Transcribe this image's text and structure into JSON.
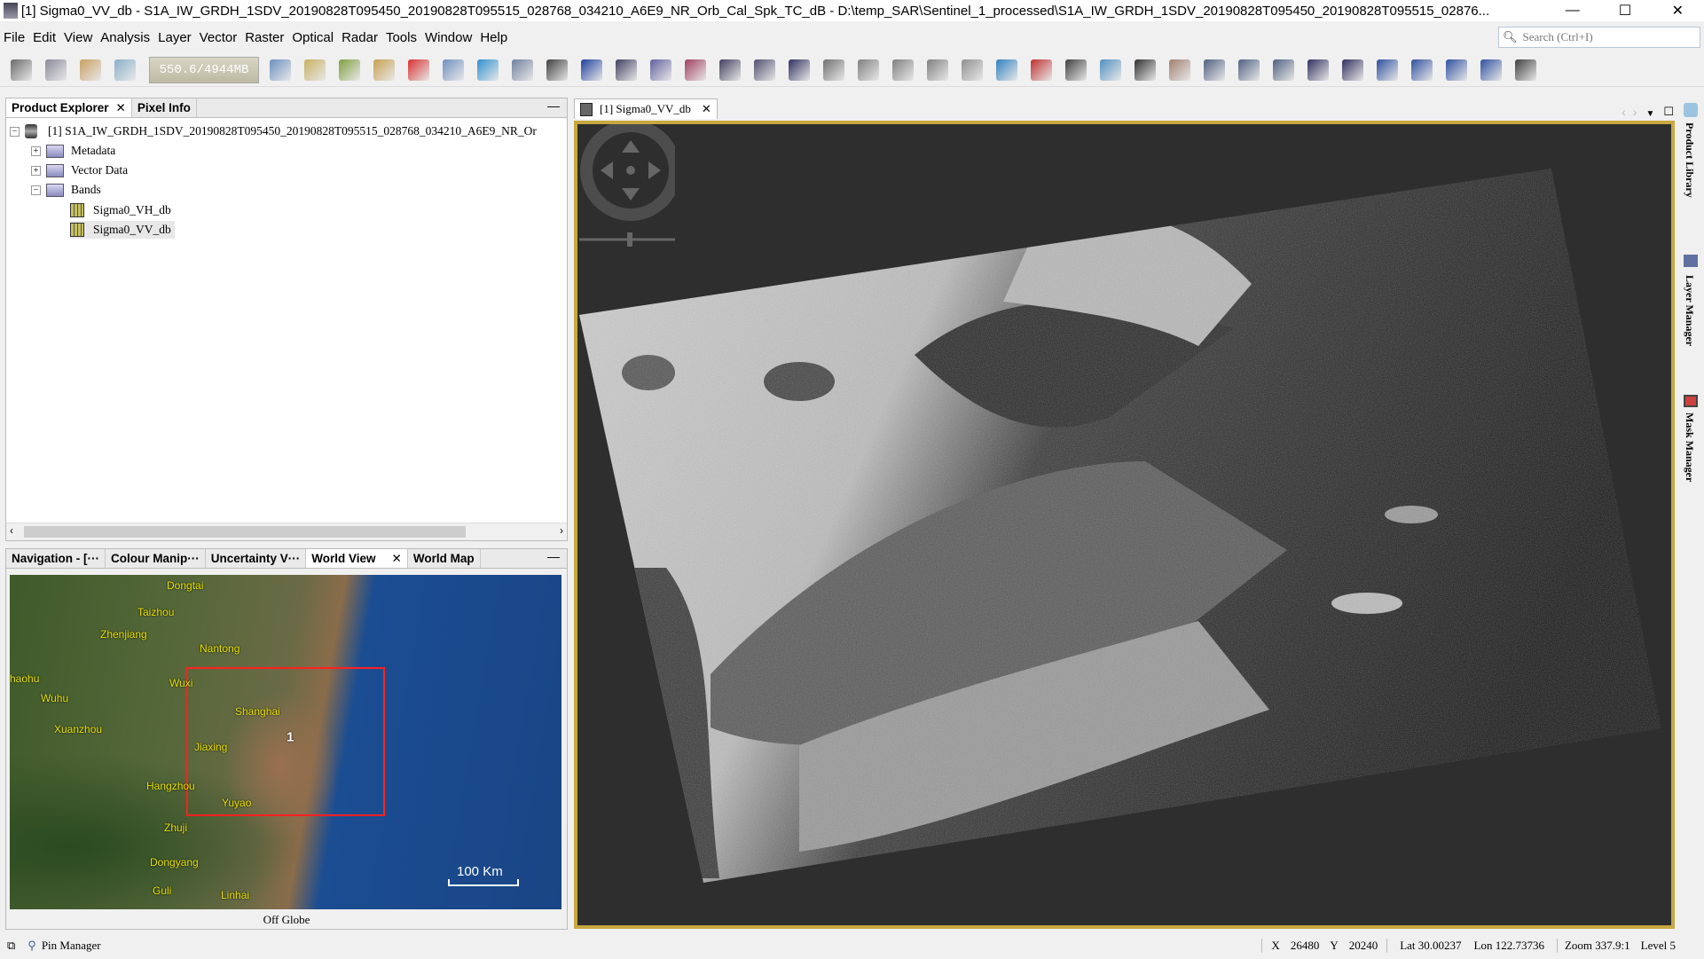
{
  "window": {
    "title": "[1] Sigma0_VV_db - S1A_IW_GRDH_1SDV_20190828T095450_20190828T095515_028768_034210_A6E9_NR_Orb_Cal_Spk_TC_dB - D:\\temp_SAR\\Sentinel_1_processed\\S1A_IW_GRDH_1SDV_20190828T095450_20190828T095515_02876...",
    "minimize": "—",
    "maximize": "☐",
    "close": "✕"
  },
  "menu": [
    "File",
    "Edit",
    "View",
    "Analysis",
    "Layer",
    "Vector",
    "Raster",
    "Optical",
    "Radar",
    "Tools",
    "Window",
    "Help"
  ],
  "search": {
    "placeholder": "Search (Ctrl+I)"
  },
  "toolbar": {
    "memory": "550.6/4944MB",
    "icons": [
      {
        "name": "open-product-icon",
        "color": "#6a6a6a"
      },
      {
        "name": "save-product-icon",
        "color": "#8a8a9a"
      },
      {
        "name": "undo-icon",
        "color": "#c8a060"
      },
      {
        "name": "redo-icon",
        "color": "#8ab0c8"
      },
      {
        "name": "globe-icon",
        "color": "#6a90c0"
      },
      {
        "name": "export-icon",
        "color": "#c8b060"
      },
      {
        "name": "import-icon",
        "color": "#80a040"
      },
      {
        "name": "bar-icon",
        "color": "#c8a050"
      },
      {
        "name": "rgb-icon",
        "color": "#d83030"
      },
      {
        "name": "layer-icon",
        "color": "#7090c0"
      },
      {
        "name": "wave-icon",
        "color": "#3090d0"
      },
      {
        "name": "spectrum-icon",
        "color": "#7080a0"
      },
      {
        "name": "edit-icon",
        "color": "#404040"
      },
      {
        "name": "phi-lambda-icon",
        "color": "#2040a0"
      },
      {
        "name": "histogram-icon",
        "color": "#404060"
      },
      {
        "name": "info-icon",
        "color": "#6060a0"
      },
      {
        "name": "pin-stats-icon",
        "color": "#a04060"
      },
      {
        "name": "profile-icon",
        "color": "#404060"
      },
      {
        "name": "scatter-icon",
        "color": "#505070"
      },
      {
        "name": "sum-icon",
        "color": "#303060"
      },
      {
        "name": "rotate-icon",
        "color": "#707070"
      },
      {
        "name": "hand-icon",
        "color": "#808080"
      },
      {
        "name": "grid-icon",
        "color": "#808080"
      },
      {
        "name": "gcp-icon",
        "color": "#808080"
      },
      {
        "name": "gcp-cloud-icon",
        "color": "#909090"
      },
      {
        "name": "eye-icon",
        "color": "#3080c0"
      },
      {
        "name": "graph-icon",
        "color": "#c03030"
      },
      {
        "name": "network-icon",
        "color": "#404040"
      },
      {
        "name": "sar-icon",
        "color": "#5090c0"
      },
      {
        "name": "select-icon",
        "color": "#303030"
      },
      {
        "name": "pan-icon",
        "color": "#a08070"
      },
      {
        "name": "zoom-icon",
        "color": "#506080"
      },
      {
        "name": "pin-icon",
        "color": "#506080"
      },
      {
        "name": "gcp-tool-icon",
        "color": "#506080"
      },
      {
        "name": "line-icon",
        "color": "#303060"
      },
      {
        "name": "polyline-icon",
        "color": "#303060"
      },
      {
        "name": "rectangle-icon",
        "color": "#3050a0"
      },
      {
        "name": "polygon-icon",
        "color": "#3050a0"
      },
      {
        "name": "ellipse-icon",
        "color": "#3050a0"
      },
      {
        "name": "magic-wand-icon",
        "color": "#3050a0"
      },
      {
        "name": "range-finder-icon",
        "color": "#404040"
      }
    ]
  },
  "product_explorer": {
    "tabs": [
      "Product Explorer",
      "Pixel Info"
    ],
    "tree": {
      "product": "[1] S1A_IW_GRDH_1SDV_20190828T095450_20190828T095515_028768_034210_A6E9_NR_Or",
      "metadata": "Metadata",
      "vector": "Vector Data",
      "bands": "Bands",
      "band_items": [
        "Sigma0_VH_db",
        "Sigma0_VV_db"
      ],
      "selected": "Sigma0_VV_db"
    }
  },
  "bottom_panel": {
    "tabs": [
      "Navigation - [···",
      "Colour Manip···",
      "Uncertainty V···",
      "World View",
      "World Map"
    ],
    "active": "World View"
  },
  "world_view": {
    "cities": [
      "Dongtai",
      "Taizhou",
      "Zhenjiang",
      "Nantong",
      "haohu",
      "Wuxi",
      "Wuhu",
      "Shanghai",
      "Xuanzhou",
      "Jiaxing",
      "Hangzhou",
      "Yuyao",
      "Zhuji",
      "Dongyang",
      "Guli",
      "Linhai"
    ],
    "footprint_label": "1",
    "scale": "100 Km",
    "footer": "Off Globe",
    "footprint_color": "#ff2020"
  },
  "image_view": {
    "tab": "[1] Sigma0_VV_db",
    "border_color": "#c8a840"
  },
  "right_sidebar": [
    "Product Library",
    "Layer Manager",
    "Mask Manager"
  ],
  "status": {
    "pin_manager": "Pin Manager",
    "x_label": "X",
    "x": "26480",
    "y_label": "Y",
    "y": "20240",
    "lat": "Lat 30.00237",
    "lon": "Lon 122.73736",
    "zoom": "Zoom 337.9:1",
    "level": "Level 5"
  }
}
